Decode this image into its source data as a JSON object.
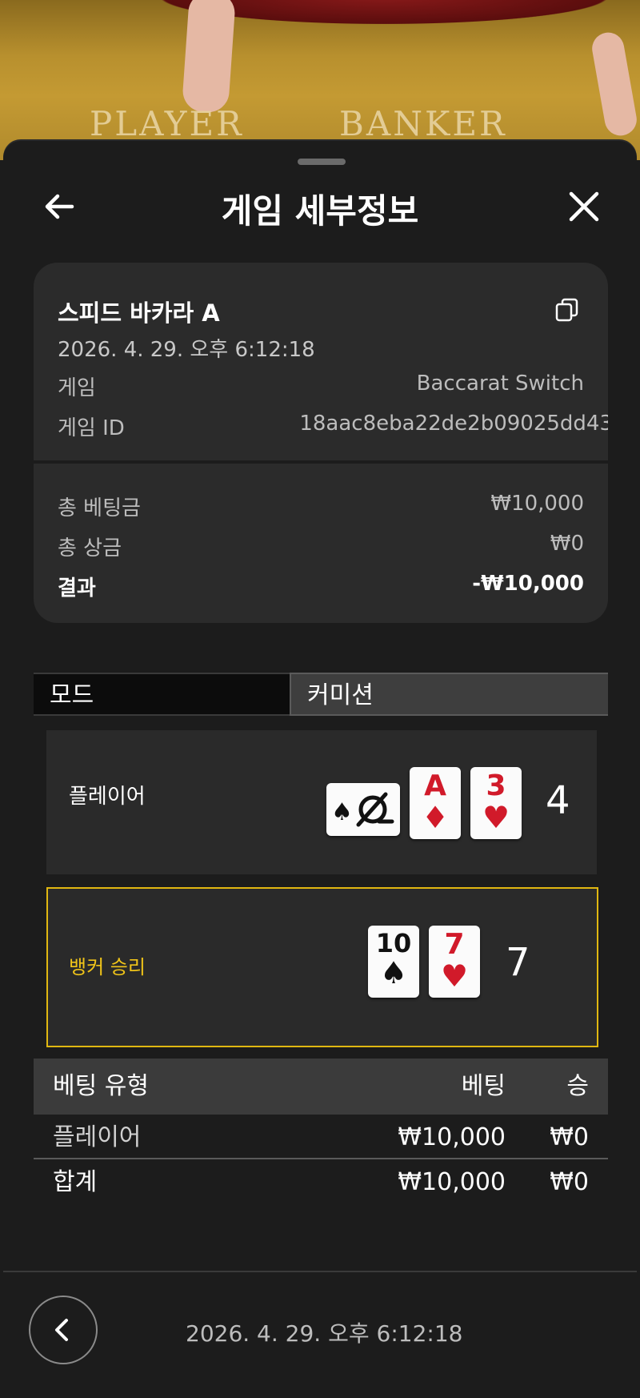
{
  "background": {
    "felt_left": "PLAYER",
    "felt_right": "BANKER"
  },
  "header": {
    "title": "게임 세부정보",
    "back_icon": "arrow-left-icon",
    "close_icon": "close-icon"
  },
  "summary": {
    "game_name": "스피드 바카라 A",
    "datetime": "2026. 4. 29. 오후 6:12:18",
    "game_label": "게임",
    "game_value": "Baccarat Switch",
    "game_id_label": "게임 ID",
    "game_id_value": "18aac8eba22de2b09025dd43",
    "total_bet_label": "총 베팅금",
    "total_bet_value": "₩10,000",
    "total_win_label": "총 상금",
    "total_win_value": "₩0",
    "result_label": "결과",
    "result_value": "-₩10,000"
  },
  "tabs": {
    "mode": "모드",
    "commission": "커미션"
  },
  "player": {
    "label": "플레이어",
    "score": "4",
    "cards": [
      {
        "rank": "Switch",
        "suit": "♠",
        "color": "#111111"
      },
      {
        "rank": "A",
        "suit": "♦",
        "color": "#d11a2a"
      },
      {
        "rank": "3",
        "suit": "♥",
        "color": "#d11a2a"
      }
    ]
  },
  "banker": {
    "label": "뱅커 승리",
    "label_color": "#f0c419",
    "score": "7",
    "cards": [
      {
        "rank": "10",
        "suit": "♠",
        "color": "#111111"
      },
      {
        "rank": "7",
        "suit": "♥",
        "color": "#d11a2a"
      }
    ]
  },
  "bets": {
    "headers": {
      "type": "베팅 유형",
      "bet": "베팅",
      "win": "승"
    },
    "rows": [
      {
        "type": "플레이어",
        "bet": "₩10,000",
        "win": "₩0"
      }
    ],
    "total": {
      "type": "합계",
      "bet": "₩10,000",
      "win": "₩0"
    }
  },
  "footer": {
    "datetime": "2026. 4. 29. 오후 6:12:18",
    "back_icon": "chevron-left-icon"
  }
}
